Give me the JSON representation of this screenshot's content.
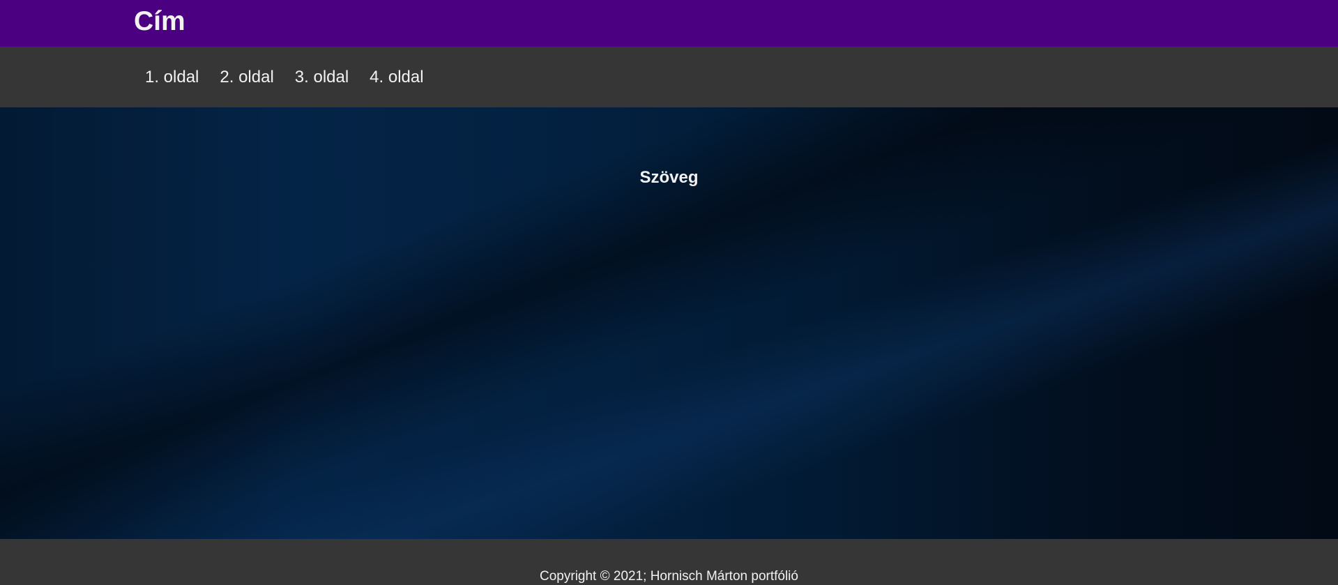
{
  "header": {
    "title": "Cím"
  },
  "nav": {
    "items": [
      {
        "label": "1. oldal"
      },
      {
        "label": "2. oldal"
      },
      {
        "label": "3. oldal"
      },
      {
        "label": "4. oldal"
      }
    ]
  },
  "main": {
    "text": "Szöveg"
  },
  "footer": {
    "copyright": "Copyright © 2021; Hornisch Márton portfólió"
  },
  "colors": {
    "header_bg": "#4b0082",
    "nav_bg": "#363636",
    "footer_bg": "#363636",
    "text": "#f2f2f2"
  }
}
